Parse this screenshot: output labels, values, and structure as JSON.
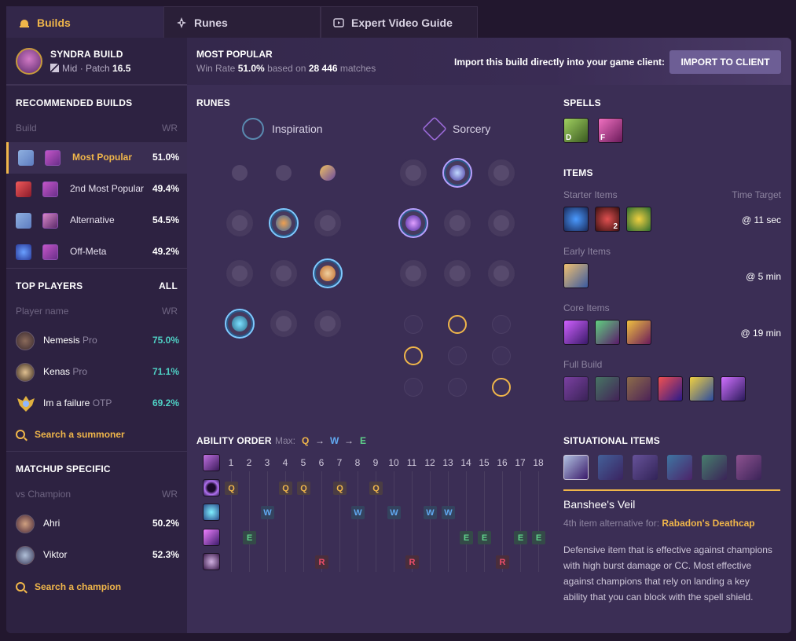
{
  "tabs": [
    {
      "label": "Builds",
      "icon": "helmet-icon"
    },
    {
      "label": "Runes",
      "icon": "rune-icon"
    },
    {
      "label": "Expert Video Guide",
      "icon": "video-icon"
    }
  ],
  "header": {
    "title": "SYNDRA BUILD",
    "role": "Mid",
    "patch_prefix": "· Patch",
    "patch": "16.5"
  },
  "most_popular": {
    "title": "MOST POPULAR",
    "wr_label": "Win Rate",
    "wr": "51.0%",
    "based_on": "based on",
    "matches": "28 446",
    "matches_label": "matches"
  },
  "import": {
    "text": "Import this build directly into your game client:",
    "button": "IMPORT TO CLIENT"
  },
  "recommended": {
    "title": "RECOMMENDED BUILDS",
    "col_build": "Build",
    "col_wr": "WR",
    "rows": [
      {
        "label": "Most Popular",
        "wr": "51.0%"
      },
      {
        "label": "2nd Most Popular",
        "wr": "49.4%"
      },
      {
        "label": "Alternative",
        "wr": "54.5%"
      },
      {
        "label": "Off-Meta",
        "wr": "49.2%"
      }
    ]
  },
  "top_players": {
    "title": "TOP PLAYERS",
    "all": "ALL",
    "col_name": "Player name",
    "col_wr": "WR",
    "rows": [
      {
        "name": "Nemesis",
        "tag": "Pro",
        "wr": "75.0%"
      },
      {
        "name": "Kenas",
        "tag": "Pro",
        "wr": "71.1%"
      },
      {
        "name": "Im a failure",
        "tag": "OTP",
        "wr": "69.2%"
      }
    ],
    "search": "Search a summoner"
  },
  "matchup": {
    "title": "MATCHUP SPECIFIC",
    "col_name": "vs Champion",
    "col_wr": "WR",
    "rows": [
      {
        "name": "Ahri",
        "wr": "50.2%"
      },
      {
        "name": "Viktor",
        "wr": "52.3%"
      }
    ],
    "search": "Search a champion"
  },
  "runes": {
    "title": "RUNES",
    "primary": "Inspiration",
    "secondary": "Sorcery"
  },
  "spells": {
    "title": "SPELLS",
    "keys": [
      "D",
      "F"
    ]
  },
  "items": {
    "title": "ITEMS",
    "starter": "Starter Items",
    "time_target": "Time Target",
    "starter_time": "@ 11 sec",
    "starter_count": "2",
    "early": "Early Items",
    "early_time": "@ 5 min",
    "core": "Core Items",
    "core_time": "@ 19 min",
    "full": "Full Build"
  },
  "ability": {
    "title": "ABILITY ORDER",
    "max": "Max:",
    "order": [
      "Q",
      "W",
      "E"
    ],
    "arrow": "→",
    "levels": [
      "1",
      "2",
      "3",
      "4",
      "5",
      "6",
      "7",
      "8",
      "9",
      "10",
      "11",
      "12",
      "13",
      "14",
      "15",
      "16",
      "17",
      "18"
    ]
  },
  "situational": {
    "title": "SITUATIONAL ITEMS",
    "name": "Banshee's Veil",
    "alt_prefix": "4th item alternative for:",
    "alt_item": "Rabadon's Deathcap",
    "desc": "Defensive item that is effective against champions with high burst damage or CC. Most effective against champions that rely on landing a key ability that you can block with the spell shield."
  },
  "colors": {
    "accent": "#f0b64a",
    "teal": "#4fd1c5",
    "q": "#f0b64a",
    "w": "#61a8f0",
    "e": "#5fd38a",
    "r": "#f04e6a"
  }
}
